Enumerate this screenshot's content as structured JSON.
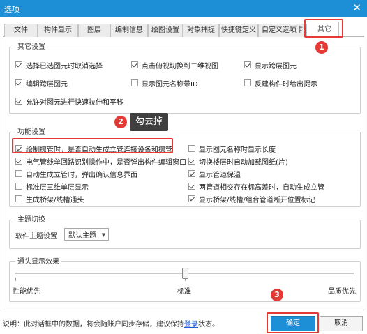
{
  "window": {
    "title": "选项",
    "close_glyph": "✕"
  },
  "tabs": [
    {
      "label": "文件"
    },
    {
      "label": "构件显示"
    },
    {
      "label": "图层"
    },
    {
      "label": "编制信息"
    },
    {
      "label": "绘图设置"
    },
    {
      "label": "对象捕捉"
    },
    {
      "label": "快捷键定义"
    },
    {
      "label": "自定义选项卡"
    },
    {
      "label": "其它",
      "active": true
    }
  ],
  "other_settings": {
    "title": "其它设置",
    "items": [
      {
        "label": "选择已选图元时取消选择",
        "checked": true
      },
      {
        "label": "点击俯视切换到二维视图",
        "checked": true
      },
      {
        "label": "显示跨层图元",
        "checked": true
      },
      {
        "label": "编辑跨层图元",
        "checked": true
      },
      {
        "label": "显示图元名称带ID",
        "checked": false
      },
      {
        "label": "反建构件时给出提示",
        "checked": false
      },
      {
        "label": "允许对图元进行快速拉伸和平移",
        "checked": true
      }
    ]
  },
  "function_settings": {
    "title": "功能设置",
    "items": [
      {
        "label": "绘制檩管时，是否自动生成立管连接设备和檩管",
        "checked": true
      },
      {
        "label": "显示图元名称时显示长度",
        "checked": false
      },
      {
        "label": "电气管线单回路识别操作中，是否弹出构件编辑窗口",
        "checked": true
      },
      {
        "label": "切换楼层时自动加载图纸(片)",
        "checked": true
      },
      {
        "label": "自动生成立管时，弹出确认信息界面",
        "checked": false
      },
      {
        "label": "显示管道保温",
        "checked": true
      },
      {
        "label": "标准层三维单层显示",
        "checked": false
      },
      {
        "label": "两管道相交存在标高差时，自动生成立管",
        "checked": true
      },
      {
        "label": "生成桥架/线槽通头",
        "checked": false
      },
      {
        "label": "显示桥架/线槽/组合管道断开位置标记",
        "checked": true
      }
    ]
  },
  "theme": {
    "title": "主题切换",
    "label": "软件主题设置",
    "selected": "默认主题"
  },
  "fitting_display": {
    "title": "通头显示效果",
    "left": "性能优先",
    "mid": "标准",
    "right": "品质优先",
    "level": 0.5
  },
  "footer": {
    "note_prefix": "说明：此对话框中的数据，将会随账户同步存储，建议保持",
    "note_link": "登录",
    "note_suffix": "状态。",
    "ok": "确定",
    "cancel": "取消"
  },
  "annotations": {
    "badge1": "1",
    "badge2": "2",
    "badge3": "3",
    "tip": "勾去掉"
  },
  "colors": {
    "title_bar": "#1d8fd6",
    "highlight": "#e53935"
  }
}
